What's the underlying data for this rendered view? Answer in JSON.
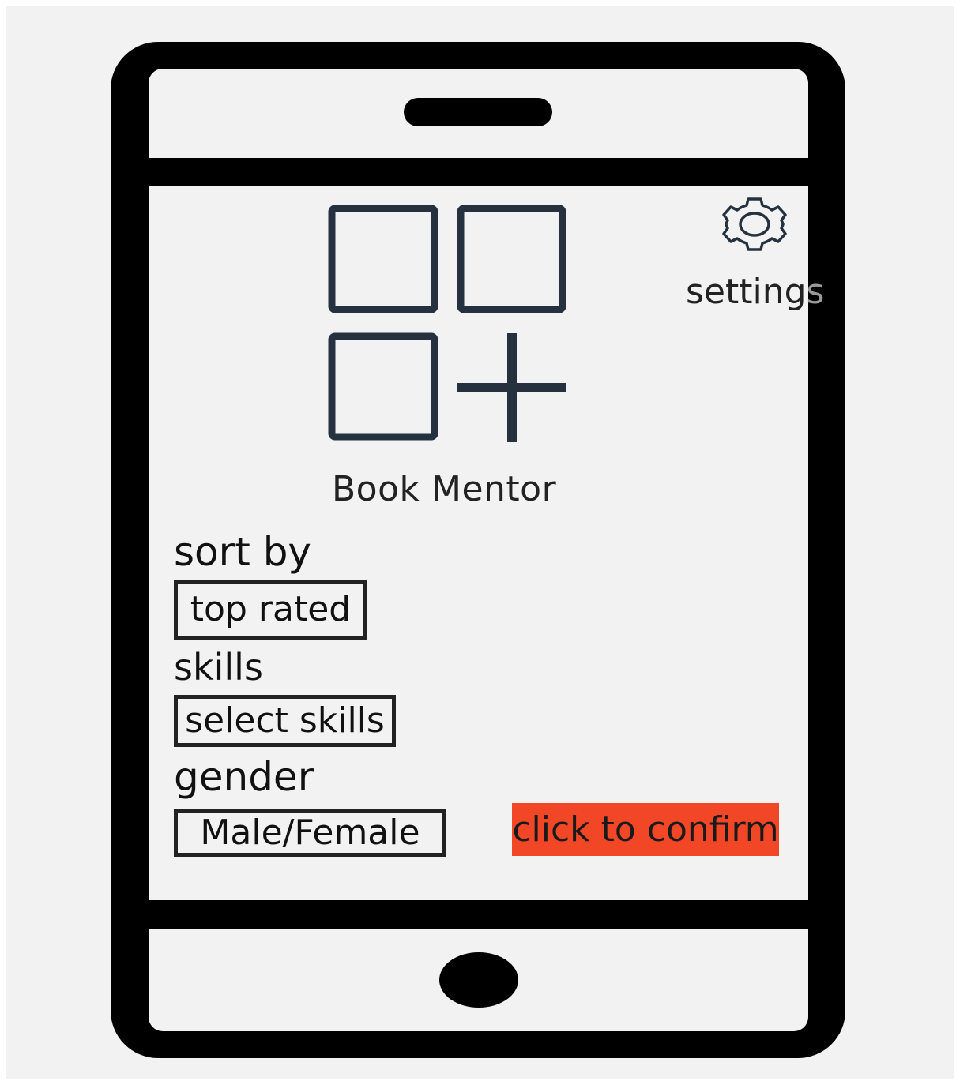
{
  "app": {
    "title": "Book Mentor",
    "icon": "apps-add-icon"
  },
  "settings": {
    "label_main": "setting",
    "label_clipped": "s",
    "icon": "gear-icon"
  },
  "form": {
    "sort_label": "sort by",
    "sort_value": "top rated",
    "skills_label": "skills",
    "skills_value": "select skills",
    "gender_label": "gender",
    "gender_value": "Male/Female",
    "confirm_label": "click to confirm"
  },
  "colors": {
    "accent": "#f24726",
    "icon_stroke": "#263140",
    "screen_bg": "#f2f2f2",
    "frame": "#000000"
  }
}
